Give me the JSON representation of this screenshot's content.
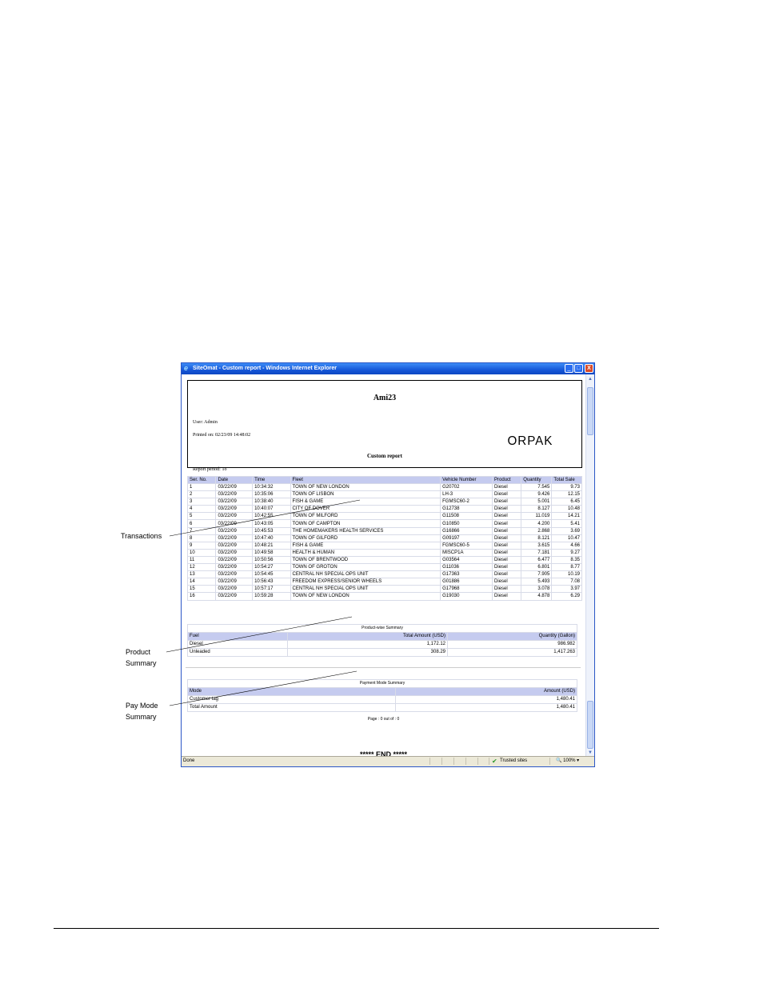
{
  "window": {
    "title": "SiteOmat - Custom report - Windows Internet Explorer",
    "min_label": "_",
    "max_label": "□",
    "close_label": "X"
  },
  "report": {
    "site_name": "Ami23",
    "user": "User: Admin",
    "printed_on": "Printed on: 02/23/09 14:48:02",
    "title": "Custom report",
    "period": "Report period: To",
    "logo_text": "ORPAK"
  },
  "transactions": {
    "headers": [
      "Ser. No.",
      "Date",
      "Time",
      "Fleet",
      "Vehicle Number",
      "Product",
      "Quantity",
      "Total Sale"
    ],
    "rows": [
      [
        "1",
        "03/22/09",
        "10:34:32",
        "TOWN OF NEW LONDON",
        "G20702",
        "Diesel",
        "7.545",
        "9.73"
      ],
      [
        "2",
        "03/22/09",
        "10:35:06",
        "TOWN OF LISBON",
        "LH-3",
        "Diesel",
        "9.426",
        "12.15"
      ],
      [
        "3",
        "03/22/09",
        "10:38:40",
        "FISH & GAME",
        "FGMSC60-2",
        "Diesel",
        "5.001",
        "6.45"
      ],
      [
        "4",
        "03/22/09",
        "10:40:07",
        "CITY OF DOVER",
        "G12738",
        "Diesel",
        "8.127",
        "10.48"
      ],
      [
        "5",
        "03/22/09",
        "10:42:55",
        "TOWN OF MILFORD",
        "G11508",
        "Diesel",
        "11.019",
        "14.21"
      ],
      [
        "6",
        "03/22/09",
        "10:43:05",
        "TOWN OF CAMPTON",
        "G10850",
        "Diesel",
        "4.200",
        "5.41"
      ],
      [
        "7",
        "03/22/09",
        "10:45:53",
        "THE HOMEMAKERS HEALTH SERVICES",
        "G16866",
        "Diesel",
        "2.868",
        "3.69"
      ],
      [
        "8",
        "03/22/09",
        "10:47:40",
        "TOWN OF GILFORD",
        "G09197",
        "Diesel",
        "8.121",
        "10.47"
      ],
      [
        "9",
        "03/22/09",
        "10:48:21",
        "FISH & GAME",
        "FGMSC60-5",
        "Diesel",
        "3.615",
        "4.66"
      ],
      [
        "10",
        "03/22/09",
        "10:49:58",
        "HEALTH & HUMAN",
        "MISCP1A",
        "Diesel",
        "7.181",
        "9.27"
      ],
      [
        "11",
        "03/22/09",
        "10:50:56",
        "TOWN OF BRENTWOOD",
        "G03564",
        "Diesel",
        "6.477",
        "8.35"
      ],
      [
        "12",
        "03/22/09",
        "10:54:27",
        "TOWN OF GROTON",
        "G11036",
        "Diesel",
        "6.801",
        "8.77"
      ],
      [
        "13",
        "03/22/09",
        "10:54:45",
        "CENTRAL NH SPECIAL OPS UNIT",
        "G17363",
        "Diesel",
        "7.905",
        "10.19"
      ],
      [
        "14",
        "03/22/09",
        "10:56:43",
        "FREEDOM EXPRESS/SENIOR WHEELS",
        "G01886",
        "Diesel",
        "5.493",
        "7.08"
      ],
      [
        "15",
        "03/22/09",
        "10:57:17",
        "CENTRAL NH SPECIAL OPS UNIT",
        "G17968",
        "Diesel",
        "3.078",
        "3.97"
      ],
      [
        "16",
        "03/22/09",
        "10:59:28",
        "TOWN OF NEW LONDON",
        "G19030",
        "Diesel",
        "4.878",
        "6.29"
      ]
    ]
  },
  "product_summary": {
    "caption": "Product-wise Summary",
    "headers": [
      "Fuel",
      "Total Amount (USD)",
      "Quantity (Gallon)"
    ],
    "rows": [
      [
        "Diesel",
        "1,172.12",
        "986.982"
      ],
      [
        "Unleaded",
        "308.29",
        "1,417.263"
      ]
    ]
  },
  "payment_summary": {
    "caption": "Payment Mode Summary",
    "headers": [
      "Mode",
      "Amount (USD)"
    ],
    "rows": [
      [
        "Customer tag",
        "1,480.41"
      ],
      [
        "Total Amount",
        "1,480.41"
      ]
    ]
  },
  "page_info": "Page : 0 out of : 0",
  "end_text": "***** END *****",
  "statusbar": {
    "done": "Done",
    "trusted": "Trusted sites",
    "zoom": "100%"
  },
  "callouts": {
    "transactions": "Transactions",
    "product_summary_line1": "Product",
    "product_summary_line2": "Summary",
    "pay_mode_line1": "Pay Mode",
    "pay_mode_line2": "Summary"
  }
}
